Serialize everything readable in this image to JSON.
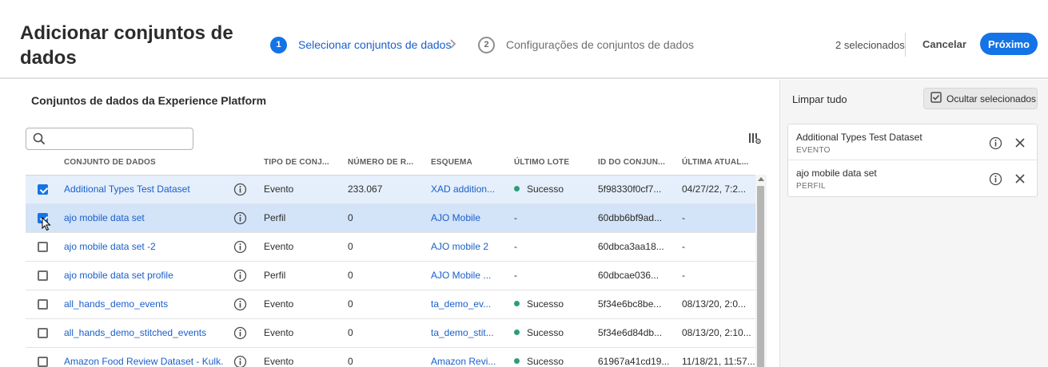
{
  "header": {
    "title": "Adicionar conjuntos de dados",
    "steps": [
      {
        "number": "1",
        "label": "Selecionar conjuntos de dados"
      },
      {
        "number": "2",
        "label": "Configurações de conjuntos de dados"
      }
    ],
    "selected_count": "2 selecionados",
    "cancel_label": "Cancelar",
    "next_label": "Próximo"
  },
  "left_panel": {
    "title": "Conjuntos de dados da Experience Platform",
    "search": {
      "value": "",
      "placeholder": ""
    },
    "columns": [
      "CONJUNTO DE DADOS",
      "TIPO DE CONJ...",
      "NÚMERO DE R...",
      "ESQUEMA",
      "ÚLTIMO LOTE",
      "ID DO CONJUN...",
      "ÚLTIMA ATUAL..."
    ],
    "rows": [
      {
        "checked": true,
        "name": "Additional Types Test Dataset",
        "type": "Evento",
        "records": "233.067",
        "schema": "XAD addition...",
        "last_batch": "Sucesso",
        "id": "5f98330f0cf7...",
        "updated": "04/27/22, 7:2..."
      },
      {
        "checked": true,
        "name": "ajo mobile data set",
        "type": "Perfil",
        "records": "0",
        "schema": "AJO Mobile",
        "last_batch": "-",
        "id": "60dbb6bf9ad...",
        "updated": "-"
      },
      {
        "checked": false,
        "name": "ajo mobile data set -2",
        "type": "Evento",
        "records": "0",
        "schema": "AJO mobile 2",
        "last_batch": "-",
        "id": "60dbca3aa18...",
        "updated": "-"
      },
      {
        "checked": false,
        "name": "ajo mobile data set profile",
        "type": "Perfil",
        "records": "0",
        "schema": "AJO Mobile ...",
        "last_batch": "-",
        "id": "60dbcae036...",
        "updated": "-"
      },
      {
        "checked": false,
        "name": "all_hands_demo_events",
        "type": "Evento",
        "records": "0",
        "schema": "ta_demo_ev...",
        "last_batch": "Sucesso",
        "id": "5f34e6bc8be...",
        "updated": "08/13/20, 2:0..."
      },
      {
        "checked": false,
        "name": "all_hands_demo_stitched_events",
        "type": "Evento",
        "records": "0",
        "schema": "ta_demo_stit...",
        "last_batch": "Sucesso",
        "id": "5f34e6d84db...",
        "updated": "08/13/20, 2:10..."
      },
      {
        "checked": false,
        "name": "Amazon Food Review Dataset - Kulk...",
        "type": "Evento",
        "records": "0",
        "schema": "Amazon Revi...",
        "last_batch": "Sucesso",
        "id": "61967a41cd19...",
        "updated": "11/18/21, 11:57..."
      }
    ]
  },
  "right_panel": {
    "clear_all_label": "Limpar tudo",
    "hide_selected_label": "Ocultar selecionados",
    "selected_items": [
      {
        "name": "Additional Types Test Dataset",
        "type": "EVENTO"
      },
      {
        "name": "ajo mobile data set",
        "type": "PERFIL"
      }
    ]
  },
  "colors": {
    "accent": "#1473e6",
    "link": "#1a5fcb",
    "success": "#2d9d78",
    "selected_row": "#e5effb",
    "hover_row": "#d3e3f8"
  },
  "icons": [
    "search-icon",
    "column-settings-icon",
    "info-icon",
    "close-icon",
    "checkbox-checked-icon",
    "mouse-cursor-icon"
  ]
}
